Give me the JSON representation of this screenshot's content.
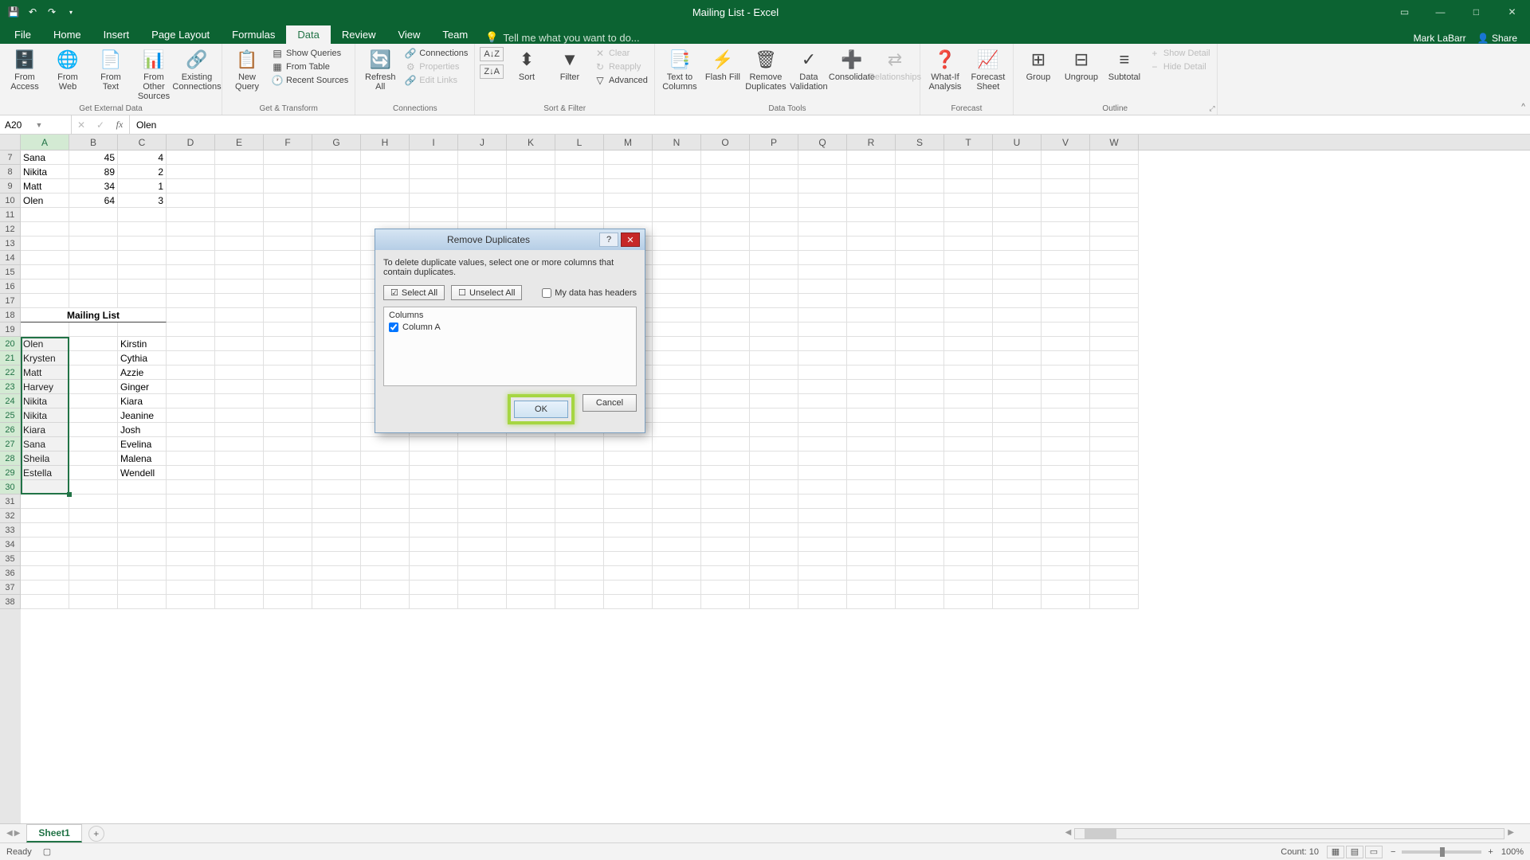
{
  "titlebar": {
    "title": "Mailing List - Excel"
  },
  "user": {
    "name": "Mark LaBarr",
    "share": "Share"
  },
  "tabs": {
    "file": "File",
    "home": "Home",
    "insert": "Insert",
    "pagelayout": "Page Layout",
    "formulas": "Formulas",
    "data": "Data",
    "review": "Review",
    "view": "View",
    "team": "Team",
    "tellme": "Tell me what you want to do..."
  },
  "ribbon": {
    "getexternal": {
      "label": "Get External Data",
      "access": "From Access",
      "web": "From Web",
      "text": "From Text",
      "other": "From Other Sources",
      "existing": "Existing Connections"
    },
    "gettransform": {
      "label": "Get & Transform",
      "newquery": "New Query",
      "showqueries": "Show Queries",
      "fromtable": "From Table",
      "recent": "Recent Sources"
    },
    "connections": {
      "label": "Connections",
      "refresh": "Refresh All",
      "conns": "Connections",
      "props": "Properties",
      "editlinks": "Edit Links"
    },
    "sortfilter": {
      "label": "Sort & Filter",
      "sort": "Sort",
      "filter": "Filter",
      "clear": "Clear",
      "reapply": "Reapply",
      "advanced": "Advanced"
    },
    "datatools": {
      "label": "Data Tools",
      "ttc": "Text to Columns",
      "flashfill": "Flash Fill",
      "removedup": "Remove Duplicates",
      "validation": "Data Validation",
      "consolidate": "Consolidate",
      "relationships": "Relationships"
    },
    "forecast": {
      "label": "Forecast",
      "whatif": "What-If Analysis",
      "sheet": "Forecast Sheet"
    },
    "outline": {
      "label": "Outline",
      "group": "Group",
      "ungroup": "Ungroup",
      "subtotal": "Subtotal",
      "showdetail": "Show Detail",
      "hidedetail": "Hide Detail"
    }
  },
  "namebox": "A20",
  "formula": "Olen",
  "columns": [
    "A",
    "B",
    "C",
    "D",
    "E",
    "F",
    "G",
    "H",
    "I",
    "J",
    "K",
    "L",
    "M",
    "N",
    "O",
    "P",
    "Q",
    "R",
    "S",
    "T",
    "U",
    "V",
    "W"
  ],
  "rows": [
    {
      "n": 7,
      "cells": {
        "A": "Sana",
        "B": "45",
        "C": "4"
      }
    },
    {
      "n": 8,
      "cells": {
        "A": "Nikita",
        "B": "89",
        "C": "2"
      }
    },
    {
      "n": 9,
      "cells": {
        "A": "Matt",
        "B": "34",
        "C": "1"
      }
    },
    {
      "n": 10,
      "cells": {
        "A": "Olen",
        "B": "64",
        "C": "3"
      }
    },
    {
      "n": 11
    },
    {
      "n": 12
    },
    {
      "n": 13
    },
    {
      "n": 14
    },
    {
      "n": 15
    },
    {
      "n": 16
    },
    {
      "n": 17
    },
    {
      "n": 18,
      "merged": true,
      "mergedText": "Mailing List"
    },
    {
      "n": 19
    },
    {
      "n": 20,
      "cells": {
        "A": "Olen",
        "C": "Kirstin"
      }
    },
    {
      "n": 21,
      "cells": {
        "A": "Krysten",
        "C": "Cythia"
      }
    },
    {
      "n": 22,
      "cells": {
        "A": "Matt",
        "C": "Azzie"
      }
    },
    {
      "n": 23,
      "cells": {
        "A": "Harvey",
        "C": "Ginger"
      }
    },
    {
      "n": 24,
      "cells": {
        "A": "Nikita",
        "C": "Kiara"
      }
    },
    {
      "n": 25,
      "cells": {
        "A": "Nikita",
        "C": "Jeanine"
      }
    },
    {
      "n": 26,
      "cells": {
        "A": "Kiara",
        "C": "Josh"
      }
    },
    {
      "n": 27,
      "cells": {
        "A": "Sana",
        "C": "Evelina"
      }
    },
    {
      "n": 28,
      "cells": {
        "A": "Sheila",
        "C": "Malena"
      }
    },
    {
      "n": 29,
      "cells": {
        "A": "Estella",
        "C": "Wendell"
      }
    },
    {
      "n": 30
    },
    {
      "n": 31
    },
    {
      "n": 32
    },
    {
      "n": 33
    },
    {
      "n": 34
    },
    {
      "n": 35
    },
    {
      "n": 36
    },
    {
      "n": 37
    },
    {
      "n": 38
    }
  ],
  "selection": {
    "startRow": 20,
    "endRow": 30,
    "col": "A"
  },
  "sheettab": {
    "name": "Sheet1"
  },
  "status": {
    "ready": "Ready",
    "count": "Count: 10",
    "zoom": "100%"
  },
  "dialog": {
    "title": "Remove Duplicates",
    "desc": "To delete duplicate values, select one or more columns that contain duplicates.",
    "selectall": "Select All",
    "unselectall": "Unselect All",
    "headers_chk": "My data has headers",
    "cols_header": "Columns",
    "col_item": "Column A",
    "ok": "OK",
    "cancel": "Cancel"
  }
}
